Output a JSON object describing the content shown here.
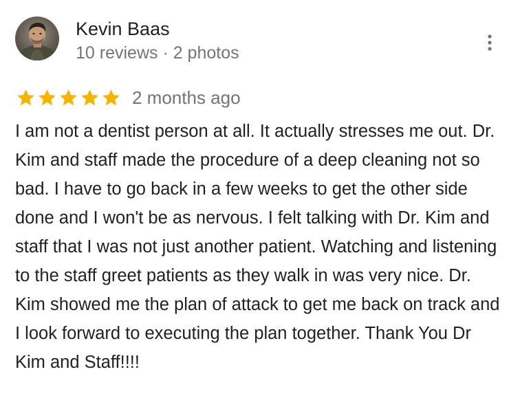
{
  "reviewer": {
    "name": "Kevin Baas",
    "meta": "10 reviews · 2 photos"
  },
  "review": {
    "rating": 5,
    "rating_max": 5,
    "date": "2 months ago",
    "text": "I am not a dentist person at all. It actually stresses me out. Dr. Kim and staff made the procedure of a deep cleaning not so bad. I have to go back in a few weeks to get the other side done and I won't be as nervous. I felt talking with Dr. Kim and staff that I was not just another patient. Watching and listening to the staff greet patients as they walk in was very nice. Dr. Kim showed me the plan of attack to get me back on track and I look forward to executing the plan together. Thank You Dr Kim and Staff!!!!"
  },
  "icons": {
    "star": "star-icon",
    "more": "more-vert-icon"
  },
  "colors": {
    "star": "#f4b400",
    "name": "#202124",
    "secondary": "#70757a"
  }
}
